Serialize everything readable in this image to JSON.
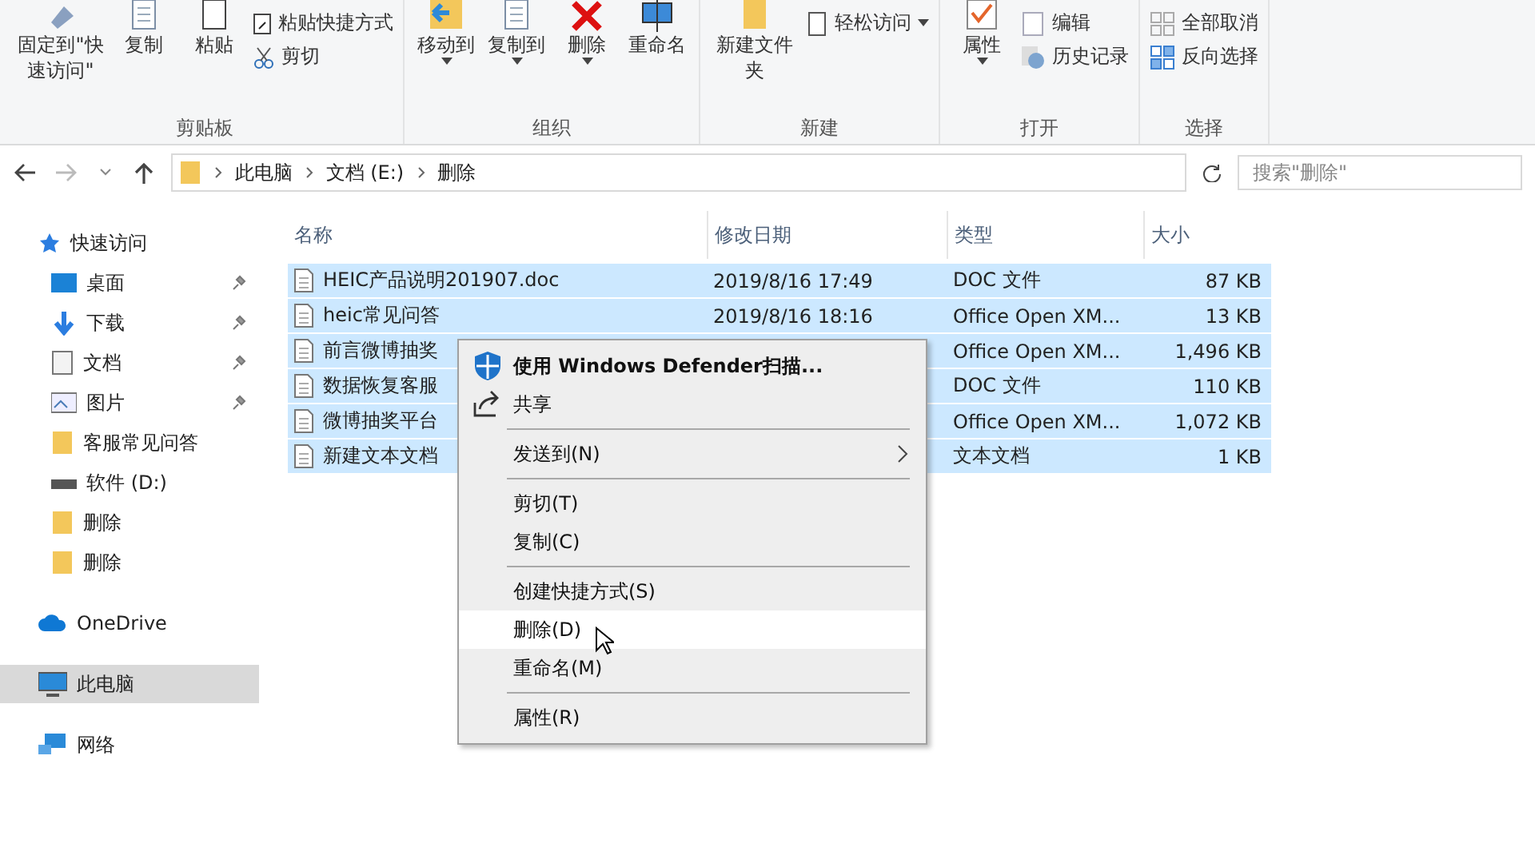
{
  "ribbon": {
    "groups": [
      {
        "label": "剪贴板",
        "buttons": [
          {
            "kind": "pin",
            "label": "固定到\"快速访问\""
          },
          {
            "kind": "copy",
            "label": "复制"
          },
          {
            "kind": "paste",
            "label": "粘贴"
          }
        ],
        "small": [
          {
            "kind": "shortcut",
            "label": "粘贴快捷方式"
          },
          {
            "kind": "cut",
            "label": "剪切"
          }
        ]
      },
      {
        "label": "组织",
        "buttons": [
          {
            "kind": "move",
            "label": "移动到",
            "caret": true
          },
          {
            "kind": "copyto",
            "label": "复制到",
            "caret": true
          },
          {
            "kind": "delete",
            "label": "删除",
            "caret": true
          },
          {
            "kind": "rename",
            "label": "重命名"
          }
        ]
      },
      {
        "label": "新建",
        "buttons": [
          {
            "kind": "folder",
            "label": "新建文件夹"
          }
        ],
        "small": [
          {
            "kind": "easy",
            "label": "轻松访问",
            "caret": true
          }
        ]
      },
      {
        "label": "打开",
        "buttons": [
          {
            "kind": "props",
            "label": "属性",
            "caret": true
          }
        ],
        "small": [
          {
            "kind": "edit",
            "label": "编辑"
          },
          {
            "kind": "history",
            "label": "历史记录"
          }
        ]
      },
      {
        "label": "选择",
        "small": [
          {
            "kind": "none",
            "label": "全部取消"
          },
          {
            "kind": "invert",
            "label": "反向选择"
          }
        ]
      }
    ]
  },
  "address": {
    "crumbs": [
      "此电脑",
      "文档 (E:)",
      "删除"
    ]
  },
  "search": {
    "placeholder": "搜索\"删除\""
  },
  "sidebar": {
    "items": [
      {
        "kind": "star",
        "label": "快速访问",
        "pinned": false,
        "selected": false,
        "head": true
      },
      {
        "kind": "desktop",
        "label": "桌面",
        "pinned": true,
        "selected": false
      },
      {
        "kind": "download",
        "label": "下载",
        "pinned": true,
        "selected": false
      },
      {
        "kind": "doc",
        "label": "文档",
        "pinned": true,
        "selected": false
      },
      {
        "kind": "pics",
        "label": "图片",
        "pinned": true,
        "selected": false
      },
      {
        "kind": "folder",
        "label": "客服常见问答",
        "pinned": false,
        "selected": false
      },
      {
        "kind": "drive",
        "label": "软件 (D:)",
        "pinned": false,
        "selected": false
      },
      {
        "kind": "folder",
        "label": "删除",
        "pinned": false,
        "selected": false
      },
      {
        "kind": "folder",
        "label": "删除",
        "pinned": false,
        "selected": false
      },
      {
        "kind": "cloud",
        "label": "OneDrive",
        "pinned": false,
        "selected": false,
        "head": true
      },
      {
        "kind": "pc",
        "label": "此电脑",
        "pinned": false,
        "selected": true,
        "head": true
      },
      {
        "kind": "net",
        "label": "网络",
        "pinned": false,
        "selected": false,
        "head": true
      }
    ]
  },
  "table": {
    "columns": [
      "名称",
      "修改日期",
      "类型",
      "大小"
    ],
    "rows": [
      {
        "name": "HEIC产品说明201907.doc",
        "date": "2019/8/16 17:49",
        "type": "DOC 文件",
        "size": "87 KB",
        "selected": true
      },
      {
        "name": "heic常见问答",
        "date": "2019/8/16 18:16",
        "type": "Office Open XM...",
        "size": "13 KB",
        "selected": true
      },
      {
        "name": "前言微博抽奖",
        "type": "Office Open XM...",
        "size": "1,496 KB",
        "selected": true
      },
      {
        "name": "数据恢复客服",
        "type": "DOC 文件",
        "size": "110 KB",
        "selected": true
      },
      {
        "name": "微博抽奖平台",
        "type": "Office Open XM...",
        "size": "1,072 KB",
        "selected": true
      },
      {
        "name": "新建文本文档",
        "type": "文本文档",
        "size": "1 KB",
        "selected": true
      }
    ]
  },
  "context_menu": {
    "items": [
      {
        "kind": "defender",
        "label": "使用 Windows Defender扫描...",
        "hovered": false
      },
      {
        "kind": "share",
        "label": "共享",
        "hovered": false
      },
      {
        "kind": "sep"
      },
      {
        "kind": "sub",
        "label": "发送到(N)",
        "hovered": false
      },
      {
        "kind": "sep"
      },
      {
        "kind": "plain",
        "label": "剪切(T)",
        "hovered": false
      },
      {
        "kind": "plain",
        "label": "复制(C)",
        "hovered": false
      },
      {
        "kind": "sep"
      },
      {
        "kind": "plain",
        "label": "创建快捷方式(S)",
        "hovered": false
      },
      {
        "kind": "plain",
        "label": "删除(D)",
        "hovered": true
      },
      {
        "kind": "plain",
        "label": "重命名(M)",
        "hovered": false
      },
      {
        "kind": "sep"
      },
      {
        "kind": "plain",
        "label": "属性(R)",
        "hovered": false
      }
    ]
  }
}
